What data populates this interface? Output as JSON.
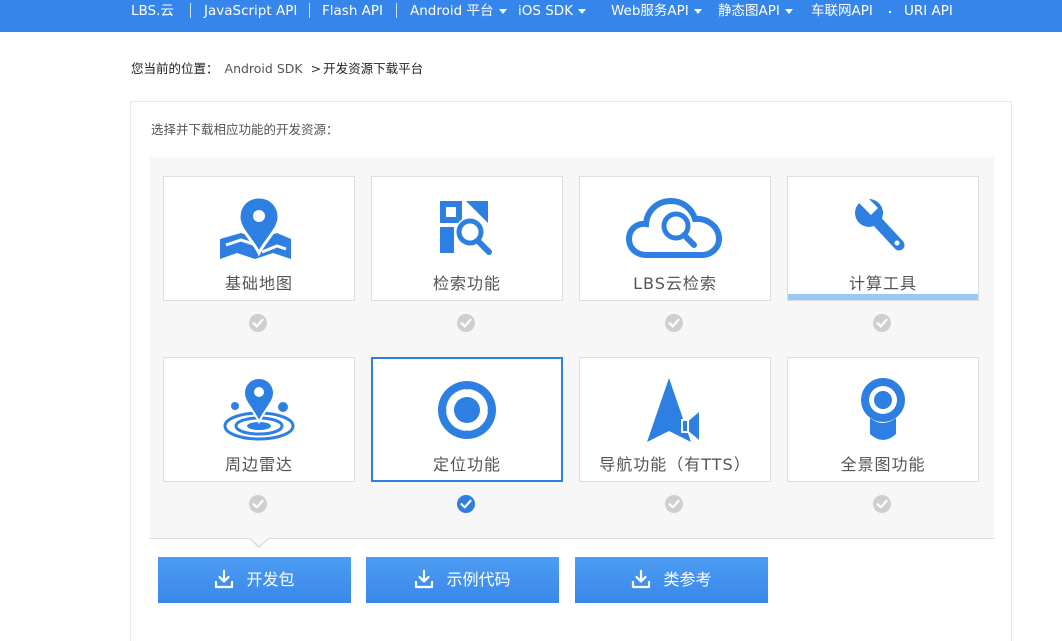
{
  "nav": {
    "items": [
      {
        "label": "LBS.云",
        "has_caret": false
      },
      {
        "label": "JavaScript API",
        "has_caret": false
      },
      {
        "label": "Flash API",
        "has_caret": false
      },
      {
        "label": "Android 平台",
        "has_caret": true
      },
      {
        "label": "iOS SDK",
        "has_caret": true
      },
      {
        "label": "Web服务API",
        "has_caret": true
      },
      {
        "label": "静态图API",
        "has_caret": true
      },
      {
        "label": "车联网API",
        "has_caret": false
      },
      {
        "label": "URI API",
        "has_caret": false
      }
    ]
  },
  "breadcrumb": {
    "prefix": "您当前的位置：",
    "parent": "Android SDK",
    "arrow": ">",
    "current": "开发资源下载平台"
  },
  "panel": {
    "prompt": "选择并下载相应功能的开发资源："
  },
  "features": [
    {
      "label": "基础地图",
      "icon": "map-pin-icon",
      "checked": false
    },
    {
      "label": "检索功能",
      "icon": "search-grid-icon",
      "checked": false
    },
    {
      "label": "LBS云检索",
      "icon": "cloud-search-icon",
      "checked": false
    },
    {
      "label": "计算工具",
      "icon": "wrench-icon",
      "checked": false
    },
    {
      "label": "周边雷达",
      "icon": "radar-icon",
      "checked": false
    },
    {
      "label": "定位功能",
      "icon": "locate-icon",
      "checked": true
    },
    {
      "label": "导航功能（有TTS）",
      "icon": "navigation-speaker-icon",
      "checked": false
    },
    {
      "label": "全景图功能",
      "icon": "panorama-icon",
      "checked": false
    }
  ],
  "downloads": [
    {
      "label": "开发包",
      "icon": "download-icon"
    },
    {
      "label": "示例代码",
      "icon": "download-icon"
    },
    {
      "label": "类参考",
      "icon": "download-icon"
    }
  ],
  "colors": {
    "brand": "#3585ea",
    "icon": "#2d80e2",
    "check_on": "#2d7fe0",
    "check_off": "#cfcfcf",
    "hover_bar": "#9cc6f3"
  }
}
